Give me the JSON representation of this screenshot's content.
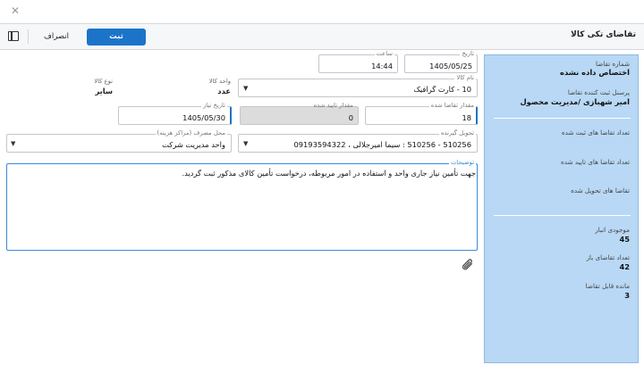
{
  "window": {
    "close_glyph": "✕"
  },
  "toolbar": {
    "title": "تقاضای تکی کالا",
    "save_label": "ثبت",
    "cancel_label": "انصراف",
    "sidebar_toggle_icon": "sidebar-toggle-icon"
  },
  "info_panel": {
    "request_number_label": "شماره تقاضا",
    "request_number_value": "اختصاص داده نشده",
    "registrar_label": "پرسنل ثبت کننده تقاضا",
    "registrar_value": "امیر شهبازی /مدیریت محصول",
    "registered_count_label": "تعداد تقاضا های ثبت شده",
    "approved_count_label": "تعداد تقاضا های تایید شده",
    "delivered_label": "تقاضا های تحویل شده",
    "stock_label": "موجودی انبار",
    "stock_value": "45",
    "open_requests_label": "تعداد تقاضای باز",
    "open_requests_value": "42",
    "remaining_label": "مانده قابل تقاضا",
    "remaining_value": "3",
    "bg_color": "#b8d8f5"
  },
  "form": {
    "date_label": "تاریخ",
    "date_value": "1405/05/25",
    "time_label": "ساعت",
    "time_value": "14:44",
    "item_name_label": "نام کالا",
    "item_name_value": "10 - کارت گرافیک",
    "unit_label": "واحد کالا",
    "unit_value": "عدد",
    "item_type_label": "نوع کالا",
    "item_type_value": "سایر",
    "requested_qty_label": "مقدار تقاضا شده",
    "requested_qty_value": "18",
    "approved_qty_label": "مقدار تایید شده",
    "approved_qty_value": "0",
    "need_date_label": "تاریخ نیاز",
    "need_date_value": "1405/05/30",
    "receiver_label": "تحویل گیرنده",
    "receiver_value": "510256 - 510256 : سیما امیرجلالی ، 09193594322",
    "cost_center_label": "محل مصرف (مراکز هزینه)",
    "cost_center_value": "واحد مدیریت شرکت",
    "description_label": "توضیحات",
    "description_value": "جهت تأمین نیاز جاری واحد و استفاده در امور مربوطه، درخواست تأمین کالای مذکور ثبت گردید."
  },
  "colors": {
    "accent": "#1c74c9",
    "panel": "#b8d8f5"
  },
  "icons": {
    "attachment": "paperclip-icon",
    "close": "close-icon"
  }
}
